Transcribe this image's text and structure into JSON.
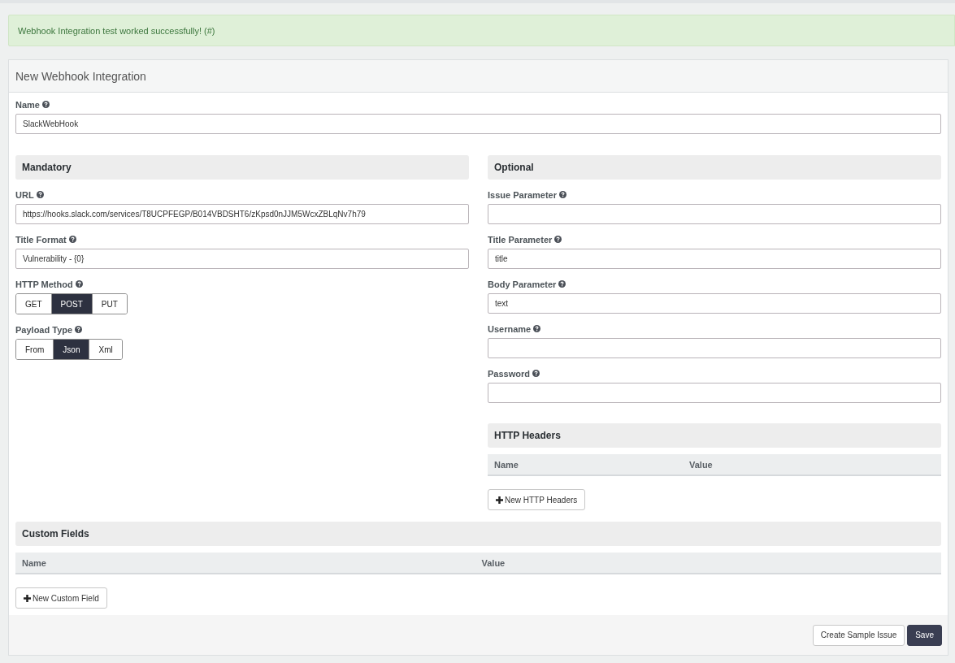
{
  "alert": {
    "text": "Webhook Integration test worked successfully! (#)"
  },
  "panel": {
    "title": "New Webhook Integration"
  },
  "name_field": {
    "label": "Name",
    "value": "SlackWebHook"
  },
  "mandatory": {
    "title": "Mandatory",
    "fields": [
      {
        "kind": "input",
        "label": "URL",
        "value": "https://hooks.slack.com/services/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"
      },
      {
        "kind": "input",
        "label": "Title Format",
        "value": "Vulnerability - {0}"
      },
      {
        "kind": "toggle",
        "label": "HTTP Method",
        "options": [
          {
            "label": "GET",
            "selected": false
          },
          {
            "label": "POST",
            "selected": true
          },
          {
            "label": "PUT",
            "selected": false
          }
        ]
      },
      {
        "kind": "toggle",
        "label": "Payload Type",
        "options": [
          {
            "label": "From",
            "selected": false
          },
          {
            "label": "Json",
            "selected": true
          },
          {
            "label": "Xml",
            "selected": false
          }
        ]
      }
    ]
  },
  "optional": {
    "title": "Optional",
    "fields": [
      {
        "kind": "input",
        "label": "Issue Parameter"
      },
      {
        "kind": "input",
        "label": "Title Parameter",
        "value": "title"
      },
      {
        "kind": "input",
        "label": "Body Parameter",
        "value": "text"
      },
      {
        "kind": "input",
        "label": "Username"
      },
      {
        "kind": "input",
        "label": "Password"
      }
    ]
  },
  "http_headers": {
    "title": "HTTP Headers",
    "columns": [
      "Name",
      "Value"
    ],
    "button": "New HTTP Headers"
  },
  "custom_fields": {
    "title": "Custom Fields",
    "columns": [
      "Name",
      "Value"
    ],
    "button": "New Custom Field"
  },
  "buttons": [
    {
      "kind": "default",
      "label": "Create Sample Issue"
    },
    {
      "kind": "primary",
      "label": "Save"
    }
  ]
}
